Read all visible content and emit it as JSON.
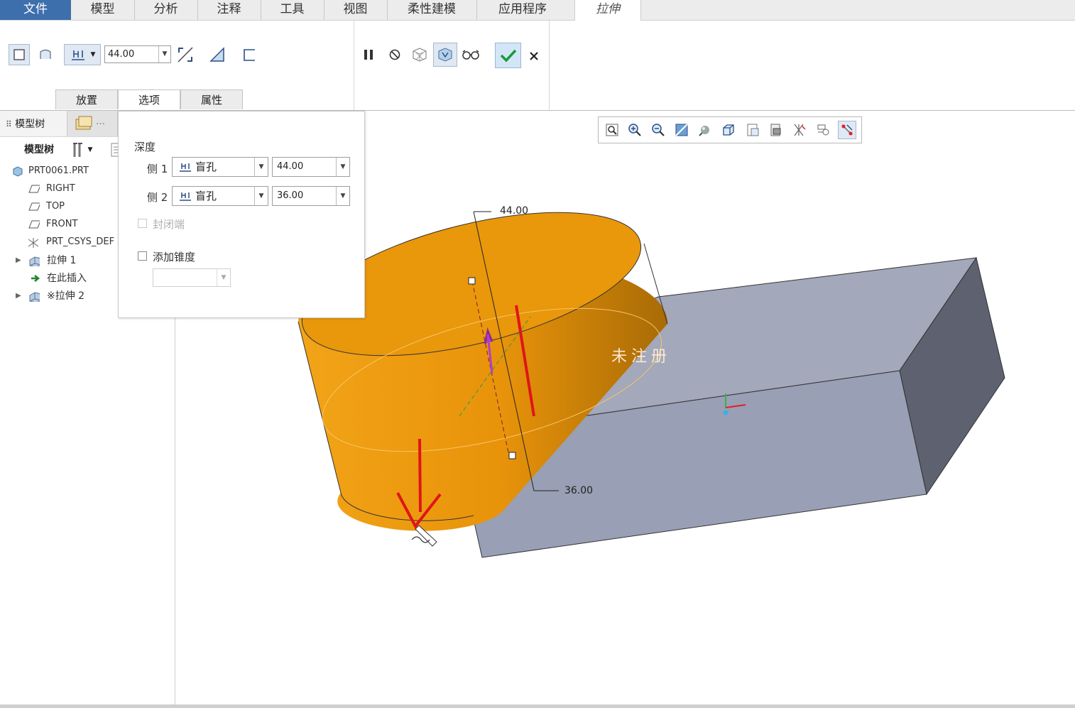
{
  "menu": {
    "items": [
      "文件",
      "模型",
      "分析",
      "注释",
      "工具",
      "视图",
      "柔性建模",
      "应用程序",
      "拉伸"
    ],
    "active_tab": "拉伸",
    "file_color": "#3e6fad"
  },
  "ribbon": {
    "depth_value": "44.00",
    "tabs": [
      "放置",
      "选项",
      "属性"
    ],
    "selected_tab": "选项"
  },
  "left_panel": {
    "tab_model_tree": "模型树",
    "header_label": "模型树",
    "tree": [
      {
        "label": "PRT0061.PRT",
        "icon": "part-icon"
      },
      {
        "label": "RIGHT",
        "icon": "datum-plane-icon"
      },
      {
        "label": "TOP",
        "icon": "datum-plane-icon"
      },
      {
        "label": "FRONT",
        "icon": "datum-plane-icon"
      },
      {
        "label": "PRT_CSYS_DEF",
        "icon": "csys-icon"
      },
      {
        "label": "拉伸 1",
        "icon": "extrude-icon"
      },
      {
        "label": "在此插入",
        "icon": "insert-here-arrow-icon"
      },
      {
        "label": "※拉伸 2",
        "icon": "extrude-icon"
      }
    ]
  },
  "options_panel": {
    "title": "深度",
    "side1_label": "侧 1",
    "side1_type": "盲孔",
    "side1_value": "44.00",
    "side2_label": "侧 2",
    "side2_type": "盲孔",
    "side2_value": "36.00",
    "capped_label": "封闭端",
    "taper_label": "添加锥度"
  },
  "viewport": {
    "dim_top": "44.00",
    "dim_bottom": "36.00",
    "watermark": "未注册",
    "cylinder_color": "#e8960a",
    "block_color": "#9aa0b4"
  }
}
